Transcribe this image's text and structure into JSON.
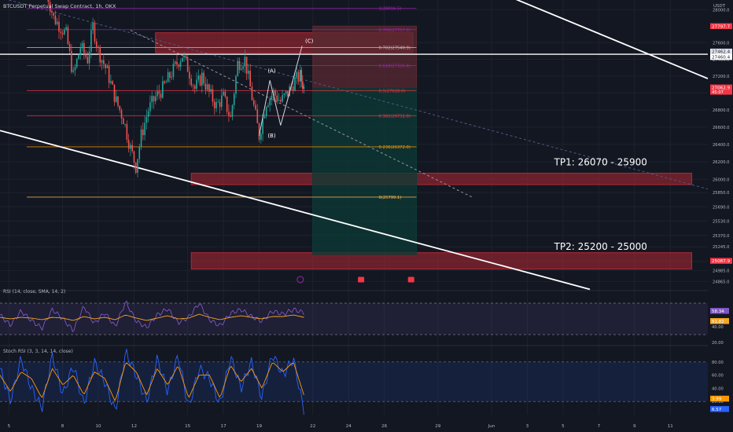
{
  "header": {
    "symbol_title": "BTCUSDT Perpetual Swap Contract, 1h, OKX",
    "currency": "USDT"
  },
  "colors": {
    "background": "#131722",
    "up": "#26a69a",
    "down": "#ef5350",
    "grid": "#1e222d",
    "text": "#b2b5be",
    "rsi_line": "#7e57c2",
    "rsi_ma": "#f5a623",
    "stoch_k": "#2962ff",
    "stoch_d": "#ff9800",
    "red_zone": "#b22833",
    "green_zone": "#0c3b35",
    "fib_line": "#787b86",
    "channel": "#ffffff",
    "price_badge": "#f23645"
  },
  "chart_data": [
    {
      "type": "candlestick",
      "title": "BTCUSDT Perpetual Swap Contract, 1h, OKX",
      "x_unit": "day of month (May 2023; Jun marker)",
      "x_ticks": [
        {
          "x": 5,
          "label": "5"
        },
        {
          "x": 8,
          "label": "8"
        },
        {
          "x": 10,
          "label": "10"
        },
        {
          "x": 12,
          "label": "12"
        },
        {
          "x": 15,
          "label": "15"
        },
        {
          "x": 17,
          "label": "17"
        },
        {
          "x": 19,
          "label": "19"
        },
        {
          "x": 22,
          "label": "22"
        },
        {
          "x": 24,
          "label": "24"
        },
        {
          "x": 26,
          "label": "26"
        },
        {
          "x": 29,
          "label": "29"
        },
        {
          "x": 32,
          "label": "Jun"
        },
        {
          "x": 34,
          "label": "3"
        },
        {
          "x": 36,
          "label": "5"
        },
        {
          "x": 38,
          "label": "7"
        },
        {
          "x": 40,
          "label": "9"
        },
        {
          "x": 42,
          "label": "11"
        }
      ],
      "xlim": [
        4.5,
        44.1
      ],
      "ylim": [
        24800,
        28100
      ],
      "y_scale": "log",
      "y_ticks": [
        28000,
        27600,
        27400,
        27200,
        27000,
        26800,
        26600,
        26400,
        26200,
        26000,
        25850,
        25690,
        25530,
        25370,
        25245,
        25085,
        24985,
        24865
      ],
      "y_tick_labels": [
        "28000.0",
        "27600.0",
        "27400.0",
        "27200.0",
        "27000.0",
        "26800.0",
        "26600.0",
        "26400.0",
        "26200.0",
        "26000.0",
        "25850.0",
        "25690.0",
        "25530.0",
        "25370.0",
        "25245.0",
        "25085.0",
        "24985.0",
        "24865.0"
      ],
      "price_path": [
        {
          "x": 7.0,
          "y": 28300
        },
        {
          "x": 7.5,
          "y": 27900
        },
        {
          "x": 8.2,
          "y": 27700
        },
        {
          "x": 8.6,
          "y": 27200
        },
        {
          "x": 9.0,
          "y": 27550
        },
        {
          "x": 9.4,
          "y": 27400
        },
        {
          "x": 9.7,
          "y": 27800
        },
        {
          "x": 10.0,
          "y": 27500
        },
        {
          "x": 10.5,
          "y": 27250
        },
        {
          "x": 11.0,
          "y": 26900
        },
        {
          "x": 11.4,
          "y": 26700
        },
        {
          "x": 11.8,
          "y": 26350
        },
        {
          "x": 12.1,
          "y": 26150
        },
        {
          "x": 12.4,
          "y": 26500
        },
        {
          "x": 12.8,
          "y": 26800
        },
        {
          "x": 13.2,
          "y": 26950
        },
        {
          "x": 13.6,
          "y": 27050
        },
        {
          "x": 14.0,
          "y": 27200
        },
        {
          "x": 14.4,
          "y": 27350
        },
        {
          "x": 14.7,
          "y": 27450
        },
        {
          "x": 15.0,
          "y": 27300
        },
        {
          "x": 15.4,
          "y": 27050
        },
        {
          "x": 15.8,
          "y": 27200
        },
        {
          "x": 16.2,
          "y": 27000
        },
        {
          "x": 16.6,
          "y": 26850
        },
        {
          "x": 17.0,
          "y": 26950
        },
        {
          "x": 17.4,
          "y": 26700
        },
        {
          "x": 17.8,
          "y": 27350
        },
        {
          "x": 18.2,
          "y": 27400
        },
        {
          "x": 18.6,
          "y": 26950
        },
        {
          "x": 19.0,
          "y": 26500
        },
        {
          "x": 19.4,
          "y": 26900
        },
        {
          "x": 19.8,
          "y": 27000
        },
        {
          "x": 20.2,
          "y": 26900
        },
        {
          "x": 20.6,
          "y": 27000
        },
        {
          "x": 21.0,
          "y": 27150
        },
        {
          "x": 21.3,
          "y": 27200
        },
        {
          "x": 21.5,
          "y": 27063
        }
      ],
      "fib_levels": [
        {
          "ratio": "1",
          "price": 28016.5,
          "label": "1(28016.5)"
        },
        {
          "ratio": "0.786",
          "price": 27757.0,
          "label": "0.786(27757.0)"
        },
        {
          "ratio": "0.702",
          "price": 27540.9,
          "label": "0.702(27540.9)"
        },
        {
          "ratio": "0.618",
          "price": 27326.4,
          "label": "0.618(27326.4)"
        },
        {
          "ratio": "0.5",
          "price": 27028.0,
          "label": "0.5(27028.0)"
        },
        {
          "ratio": "0.382",
          "price": 26732.8,
          "label": "0.382(26732.8)"
        },
        {
          "ratio": "0.236",
          "price": 26372.0,
          "label": "0.236(26372.0)"
        },
        {
          "ratio": "0",
          "price": 25799.1,
          "label": "0(25799.1)"
        }
      ],
      "fib_x_range": [
        6.0,
        27.8
      ],
      "wave_labels": [
        {
          "text": "(A)",
          "x": 19.7,
          "y": 27240
        },
        {
          "text": "(B)",
          "x": 19.7,
          "y": 26480
        },
        {
          "text": "(C)",
          "x": 21.8,
          "y": 27600
        }
      ],
      "wave_path": [
        {
          "x": 19.0,
          "y": 26500
        },
        {
          "x": 19.6,
          "y": 27150
        },
        {
          "x": 20.2,
          "y": 26620
        },
        {
          "x": 21.4,
          "y": 27560
        }
      ],
      "zones": [
        {
          "name": "resistance-zone",
          "x0": 13.2,
          "x1": 27.6,
          "y0": 27480,
          "y1": 27720,
          "color": "#b22833"
        },
        {
          "name": "tp1-zone",
          "x0": 15.2,
          "x1": 43.2,
          "y0": 25940,
          "y1": 26070,
          "color": "#b22833"
        },
        {
          "name": "tp2-zone",
          "x0": 15.2,
          "x1": 43.2,
          "y0": 25000,
          "y1": 25180,
          "color": "#b22833"
        },
        {
          "name": "short-stop-zone",
          "x0": 22.0,
          "x1": 27.8,
          "y0": 27060,
          "y1": 27800,
          "color": "#5a2a32"
        },
        {
          "name": "short-target-zone",
          "x0": 22.0,
          "x1": 27.8,
          "y0": 25160,
          "y1": 27060,
          "color": "#0c3b35"
        }
      ],
      "horizontal_lines": [
        {
          "name": "white-level",
          "price": 27460.4,
          "color": "#ffffff"
        }
      ],
      "channel_lines": [
        {
          "name": "upper-channel",
          "x0": 28.2,
          "y0": 28600,
          "x1": 44.1,
          "y1": 27170
        },
        {
          "name": "lower-channel",
          "x0": 4.5,
          "y0": 26560,
          "x1": 37.5,
          "y1": 24780
        }
      ],
      "dashed_trend_lines": [
        {
          "name": "dashed-trend-1",
          "x0": 4.5,
          "y0": 28150,
          "x1": 44.1,
          "y1": 25890,
          "color": "#4a5a8a"
        },
        {
          "name": "dashed-trend-2",
          "x0": 11.8,
          "y0": 27750,
          "x1": 31.0,
          "y1": 25790,
          "color": "#9598a1"
        }
      ],
      "annotations": [
        {
          "text": "TP1: 26070 - 25900",
          "x": 35.5,
          "y": 26160
        },
        {
          "text": "TP2: 25200 - 25000",
          "x": 35.5,
          "y": 25210
        }
      ],
      "price_badges": [
        {
          "value": "27797.7",
          "price": 27797.7,
          "color": "#f23645"
        },
        {
          "value": "27462.4",
          "price": 27490,
          "color": "#e0e3eb",
          "text_color": "#131722"
        },
        {
          "value": "27460.4",
          "price": 27425,
          "color": "#ffffff",
          "text_color": "#131722"
        },
        {
          "value": "27062.9",
          "price": 27062.9,
          "color": "#f23645",
          "sub": "45:07"
        },
        {
          "value": "25087.9",
          "price": 25087.9,
          "color": "#f23645"
        }
      ],
      "event_icons": [
        {
          "name": "bolt-event-icon",
          "x": 21.3
        },
        {
          "name": "calendar-event-icon-1",
          "x": 24.7
        },
        {
          "name": "calendar-event-icon-2",
          "x": 27.5
        }
      ]
    },
    {
      "type": "line",
      "title": "RSI (14, close, SMA, 14, 2)",
      "ylim": [
        20,
        80
      ],
      "y_ticks": [
        40,
        20
      ],
      "y_tick_labels": [
        "40.00",
        "20.00"
      ],
      "bands": {
        "upper": 70,
        "lower": 30
      },
      "series": [
        {
          "name": "RSI",
          "values_summary": [
            55,
            42,
            60,
            48,
            38,
            62,
            50,
            35,
            66,
            44,
            58,
            40,
            72,
            47,
            39,
            55,
            63,
            45,
            52,
            70,
            49,
            41,
            57,
            62,
            53,
            47,
            60,
            56,
            62,
            58
          ]
        },
        {
          "name": "RSI-based MA",
          "values_summary": [
            52,
            50,
            52,
            51,
            49,
            52,
            51,
            48,
            53,
            50,
            52,
            49,
            55,
            51,
            48,
            51,
            54,
            50,
            51,
            56,
            52,
            49,
            52,
            54,
            52,
            50,
            53,
            53,
            55,
            52
          ]
        }
      ],
      "last_values": [
        {
          "value": "58.34",
          "color": "#7e57c2"
        },
        {
          "value": "51.82",
          "color": "#f5a623"
        }
      ]
    },
    {
      "type": "line",
      "title": "Stoch RSI (3, 3, 14, 14, close)",
      "ylim": [
        0,
        100
      ],
      "y_ticks": [
        80,
        60,
        40,
        20
      ],
      "y_tick_labels": [
        "80.00",
        "60.00",
        "40.00",
        "20.00"
      ],
      "bands": {
        "upper": 80,
        "lower": 20
      },
      "series": [
        {
          "name": "K",
          "values_summary": [
            70,
            20,
            85,
            40,
            10,
            90,
            30,
            75,
            15,
            80,
            50,
            5,
            95,
            60,
            20,
            85,
            35,
            90,
            10,
            70,
            55,
            15,
            88,
            40,
            80,
            25,
            92,
            60,
            85,
            6
          ]
        },
        {
          "name": "D",
          "values_summary": [
            60,
            35,
            65,
            55,
            25,
            70,
            45,
            60,
            30,
            65,
            55,
            20,
            80,
            65,
            30,
            70,
            45,
            75,
            25,
            60,
            60,
            25,
            75,
            50,
            70,
            40,
            80,
            65,
            80,
            30
          ]
        }
      ],
      "last_values": [
        {
          "value": "6.57",
          "color": "#2962ff"
        },
        {
          "value": "3.99",
          "color": "#ff9800"
        }
      ]
    }
  ]
}
